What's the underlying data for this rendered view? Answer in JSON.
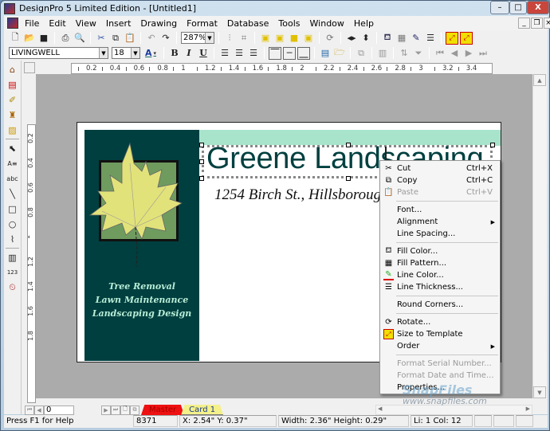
{
  "window": {
    "title": "DesignPro 5  Limited Edition - [Untitled1]",
    "controls": {
      "minimize": "–",
      "maximize": "□",
      "close": "X"
    }
  },
  "menubar": {
    "items": [
      "File",
      "Edit",
      "View",
      "Insert",
      "Drawing",
      "Format",
      "Database",
      "Tools",
      "Window",
      "Help"
    ],
    "mdi_controls": {
      "minimize": "_",
      "restore": "❐",
      "close": "×"
    }
  },
  "toolbar1": {
    "zoom_value": "287%",
    "icons": [
      "new-icon",
      "open-icon",
      "save-icon",
      "print-icon",
      "print-preview-icon",
      "cut-icon",
      "copy-icon",
      "paste-icon",
      "undo-icon",
      "redo-icon",
      "align-objects-icon",
      "crop-icon",
      "bring-forward-icon",
      "send-backward-icon",
      "bring-to-front-icon",
      "send-to-back-icon",
      "rotate-icon",
      "flip-horizontal-icon",
      "flip-vertical-icon",
      "fill-color-icon",
      "fill-pattern-icon",
      "line-color-icon",
      "line-thickness-icon",
      "size-to-template-icon",
      "size-to-template-lock-icon"
    ]
  },
  "toolbar2": {
    "font_name": "LIVINGWELL",
    "font_size": "18",
    "bold": "B",
    "italic": "I",
    "underline": "U",
    "font_color_letter": "A",
    "icons": [
      "align-left-icon",
      "align-center-icon",
      "align-right-icon",
      "valign-top-icon",
      "valign-middle-icon",
      "valign-bottom-icon",
      "database-table-icon",
      "database-open-icon",
      "merge-fields-icon",
      "table-icon",
      "sort-icon",
      "filter-icon",
      "first-record-icon",
      "previous-record-icon",
      "next-record-icon",
      "last-record-icon"
    ]
  },
  "left_toolbar": {
    "icons": [
      "house-icon",
      "layout-icon",
      "wizard-icon",
      "clipart-icon",
      "image-icon",
      "pointer-icon",
      "text-box-icon",
      "curved-text-icon",
      "line-tool-icon",
      "rectangle-tool-icon",
      "ellipse-tool-icon",
      "polygon-tool-icon",
      "barcode-icon",
      "serial-number-icon",
      "date-time-icon"
    ]
  },
  "hruler": {
    "ticks": [
      "0.2",
      "0.4",
      "0.6",
      "0.8",
      "1",
      "1.2",
      "1.4",
      "1.6",
      "1.8",
      "2",
      "2.2",
      "2.4",
      "2.6",
      "2.8",
      "3",
      "3.2",
      "3.4"
    ]
  },
  "vruler": {
    "ticks": [
      "0.2",
      "0.4",
      "0.6",
      "0.8",
      "1",
      "1.2",
      "1.4",
      "1.6",
      "1.8"
    ]
  },
  "card": {
    "title": "Greene Landscaping",
    "address": "1254 Birch St., Hillsborough",
    "services": [
      "Tree Removal",
      "Lawn Maintenance",
      "Landscaping Design"
    ],
    "colors": {
      "panel": "#003f3f",
      "mint": "#a8e4cc",
      "leaf": "#e2e27a",
      "leafbox": "#6f9b5f",
      "title": "#004040"
    }
  },
  "context_menu": {
    "items": [
      {
        "label": "Cut",
        "shortcut": "Ctrl+X",
        "icon": "scissors-icon",
        "enabled": true
      },
      {
        "label": "Copy",
        "shortcut": "Ctrl+C",
        "icon": "copy-icon",
        "enabled": true
      },
      {
        "label": "Paste",
        "shortcut": "Ctrl+V",
        "icon": "paste-icon",
        "enabled": false
      },
      {
        "label": "Font...",
        "enabled": true
      },
      {
        "label": "Alignment",
        "submenu": true,
        "enabled": true
      },
      {
        "label": "Line Spacing...",
        "enabled": true
      },
      {
        "label": "Fill Color...",
        "icon": "fill-bucket-icon",
        "enabled": true
      },
      {
        "label": "Fill Pattern...",
        "icon": "pattern-icon",
        "enabled": true
      },
      {
        "label": "Line Color...",
        "icon": "pen-icon",
        "enabled": true
      },
      {
        "label": "Line Thickness...",
        "icon": "line-thickness-icon",
        "enabled": true
      },
      {
        "label": "Round Corners...",
        "enabled": true
      },
      {
        "label": "Rotate...",
        "icon": "rotate-icon",
        "enabled": true
      },
      {
        "label": "Size to Template",
        "icon": "size-template-icon",
        "enabled": true
      },
      {
        "label": "Order",
        "submenu": true,
        "enabled": true
      },
      {
        "label": "Format Serial Number...",
        "enabled": false
      },
      {
        "label": "Format Date and Time...",
        "enabled": false
      },
      {
        "label": "Properties...",
        "enabled": true
      }
    ]
  },
  "bottom": {
    "record_number": "0",
    "tabs": [
      {
        "label": "Master",
        "color": "#ee1111"
      },
      {
        "label": "Card 1",
        "color": "#f4f08a"
      }
    ]
  },
  "statusbar": {
    "help": "Press F1 for Help",
    "code": "8371",
    "position": "X: 2.54\"  Y: 0.37\"",
    "size": "Width: 2.36\"   Height: 0.29\"",
    "cursor": "Li: 1   Col: 12"
  },
  "watermark": {
    "brand": "SnapFiles",
    "url": "www.snapfiles.com"
  }
}
